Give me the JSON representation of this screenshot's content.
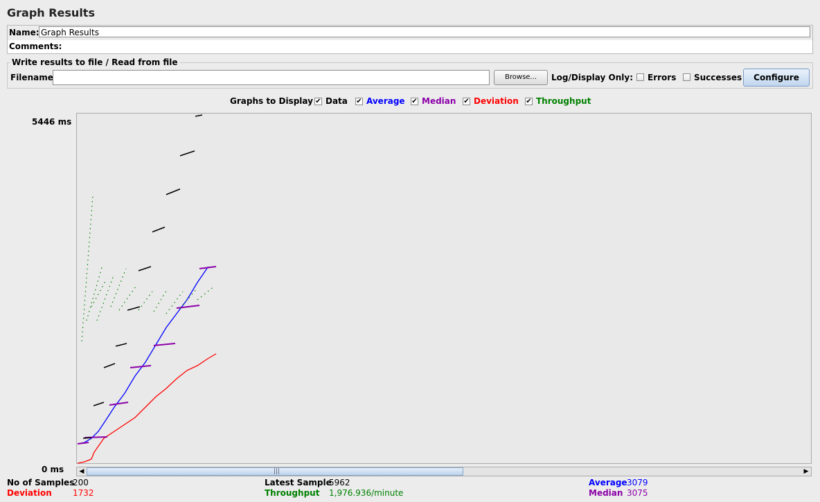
{
  "title": "Graph Results",
  "name_field": {
    "label": "Name:",
    "value": "Graph Results"
  },
  "comments_field": {
    "label": "Comments:"
  },
  "file_section": {
    "legend": "Write results to file / Read from file",
    "filename_label": "Filename",
    "filename_value": "",
    "browse_label": "Browse...",
    "log_display_label": "Log/Display Only:",
    "errors_label": "Errors",
    "errors_checked": false,
    "successes_label": "Successes",
    "successes_checked": false,
    "configure_label": "Configure"
  },
  "graphs_to_display": {
    "label": "Graphs to Display",
    "options": [
      {
        "label": "Data",
        "checked": true,
        "color": "#000000"
      },
      {
        "label": "Average",
        "checked": true,
        "color": "#0000ff"
      },
      {
        "label": "Median",
        "checked": true,
        "color": "#8b00a8"
      },
      {
        "label": "Deviation",
        "checked": true,
        "color": "#ff0000"
      },
      {
        "label": "Throughput",
        "checked": true,
        "color": "#008000"
      }
    ]
  },
  "chart_data": {
    "type": "line",
    "y_max_label": "5446  ms",
    "y_min_label": "0  ms",
    "ylim": [
      0,
      5446
    ],
    "x_samples": 200,
    "series_colors": {
      "data": "#000000",
      "average": "#0000ff",
      "median": "#8b00a8",
      "deviation": "#ff0000",
      "throughput": "#008000"
    },
    "final_values": {
      "average": 3079,
      "median": 3075,
      "deviation": 1732,
      "latest_sample": 5962
    }
  },
  "stats": {
    "samples_label": "No of Samples",
    "samples_value": "200",
    "deviation_label": "Deviation",
    "deviation_value": "1732",
    "latest_label": "Latest Sample",
    "latest_value": "5962",
    "throughput_label": "Throughput",
    "throughput_value": "1,976.936/minute",
    "average_label": "Average",
    "average_value": "3079",
    "median_label": "Median",
    "median_value": "3075"
  },
  "colors": {
    "average": "#0000ff",
    "median": "#8b00a8",
    "deviation": "#ff0000",
    "throughput": "#008000"
  }
}
